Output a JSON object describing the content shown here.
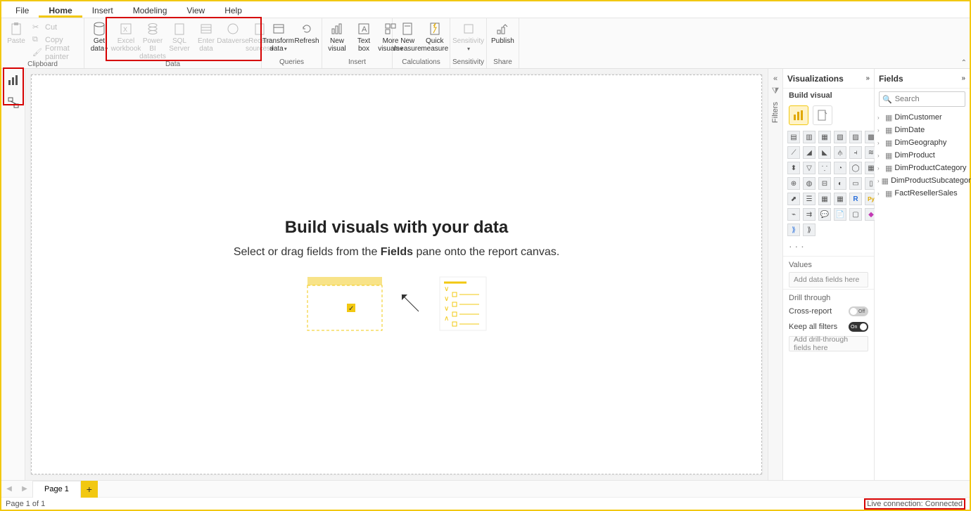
{
  "menu": {
    "file": "File",
    "home": "Home",
    "insert": "Insert",
    "modeling": "Modeling",
    "view": "View",
    "help": "Help"
  },
  "ribbon": {
    "clipboard": {
      "label": "Clipboard",
      "paste": "Paste",
      "cut": "Cut",
      "copy": "Copy",
      "format_painter": "Format painter"
    },
    "data": {
      "label": "Data",
      "get_data": "Get\ndata",
      "excel": "Excel\nworkbook",
      "pbi_ds": "Power BI\ndatasets",
      "sql": "SQL\nServer",
      "enter": "Enter\ndata",
      "dataverse": "Dataverse",
      "recent": "Recent\nsources"
    },
    "queries": {
      "label": "Queries",
      "transform": "Transform\ndata",
      "refresh": "Refresh"
    },
    "insert": {
      "label": "Insert",
      "new_visual": "New\nvisual",
      "text_box": "Text\nbox",
      "more_visuals": "More\nvisuals"
    },
    "calc": {
      "label": "Calculations",
      "new_measure": "New\nmeasure",
      "quick_measure": "Quick\nmeasure"
    },
    "sens": {
      "label": "Sensitivity",
      "sensitivity": "Sensitivity"
    },
    "share": {
      "label": "Share",
      "publish": "Publish"
    }
  },
  "filters": {
    "label": "Filters"
  },
  "viz": {
    "title": "Visualizations",
    "build": "Build visual",
    "values": "Values",
    "add_fields": "Add data fields here",
    "drill": "Drill through",
    "cross": "Cross-report",
    "keep": "Keep all filters",
    "add_drill": "Add drill-through fields here",
    "off": "Off",
    "on": "On"
  },
  "fields": {
    "title": "Fields",
    "search_ph": "Search",
    "tables": [
      "DimCustomer",
      "DimDate",
      "DimGeography",
      "DimProduct",
      "DimProductCategory",
      "DimProductSubcategory",
      "FactResellerSales"
    ]
  },
  "canvas": {
    "title": "Build visuals with your data",
    "subtitle_before": "Select or drag fields from the ",
    "subtitle_bold": "Fields",
    "subtitle_after": " pane onto the report canvas."
  },
  "pagetabs": {
    "page1": "Page 1"
  },
  "status": {
    "page": "Page 1 of 1",
    "conn": "Live connection: Connected"
  }
}
